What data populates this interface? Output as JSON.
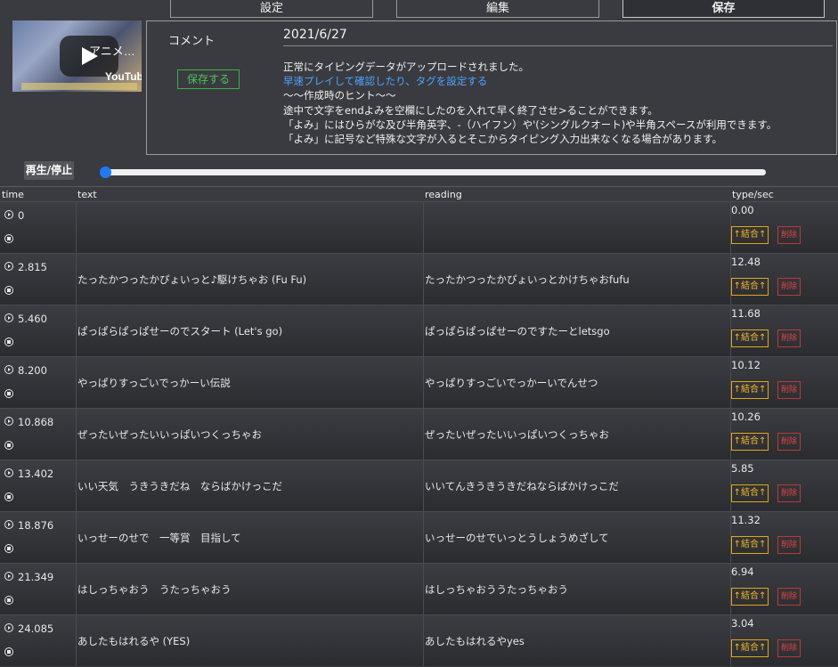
{
  "tabs": [
    "設定",
    "編集",
    "保存"
  ],
  "video": {
    "title_partial": "アニメ…",
    "brand": "YouTube"
  },
  "comment": {
    "label": "コメント",
    "date": "2021/6/27",
    "save_label": "保存する",
    "messages": [
      "正常にタイピングデータがアップロードされました。",
      "早速プレイして確認したり、タグを設定する",
      "～～作成時のヒント～～",
      "途中で文字をendよみを空欄にしたのを入れて早く終了させ>ることができます。",
      "「よみ」にはひらがな及び半角英字、-（ハイフン）や'(シングルクオート)や半角スペースが利用できます。",
      "「よみ」に記号など特殊な文字が入るとそこからタイピング入力出来なくなる場合があります。"
    ]
  },
  "player": {
    "play_label": "再生/停止",
    "progress": 0
  },
  "table": {
    "headers": {
      "time": "time",
      "text": "text",
      "reading": "reading",
      "tps": "type/sec"
    },
    "merge_label": "↑結合↑",
    "delete_label": "削除",
    "rows": [
      {
        "time": "0",
        "text": "",
        "reading": "",
        "tps": "0.00"
      },
      {
        "time": "2.815",
        "text": "たったかつったかぴょいっと♪駆けちゃお (Fu Fu)",
        "reading": "たったかつったかぴょいっとかけちゃおfufu",
        "tps": "12.48"
      },
      {
        "time": "5.460",
        "text": "ぱっぱらぱっぱせーのでスタート (Let's go)",
        "reading": "ぱっぱらぱっぱせーのですたーとletsgo",
        "tps": "11.68"
      },
      {
        "time": "8.200",
        "text": "やっぱりすっごいでっかーい伝説",
        "reading": "やっぱりすっごいでっかーいでんせつ",
        "tps": "10.12"
      },
      {
        "time": "10.868",
        "text": "ぜったいぜったいいっぱいつくっちゃお",
        "reading": "ぜったいぜったいいっぱいつくっちゃお",
        "tps": "10.26"
      },
      {
        "time": "13.402",
        "text": "いい天気　うきうきだね　ならばかけっこだ",
        "reading": "いいてんきうきうきだねならばかけっこだ",
        "tps": "5.85"
      },
      {
        "time": "18.876",
        "text": "いっせーのせで　一等賞　目指して",
        "reading": "いっせーのせでいっとうしょうめざして",
        "tps": "11.32"
      },
      {
        "time": "21.349",
        "text": "はしっちゃおう　うたっちゃおう",
        "reading": "はしっちゃおううたっちゃおう",
        "tps": "6.94"
      },
      {
        "time": "24.085",
        "text": "あしたもはれるや (YES)",
        "reading": "あしたもはれるやyes",
        "tps": "3.04"
      }
    ]
  }
}
